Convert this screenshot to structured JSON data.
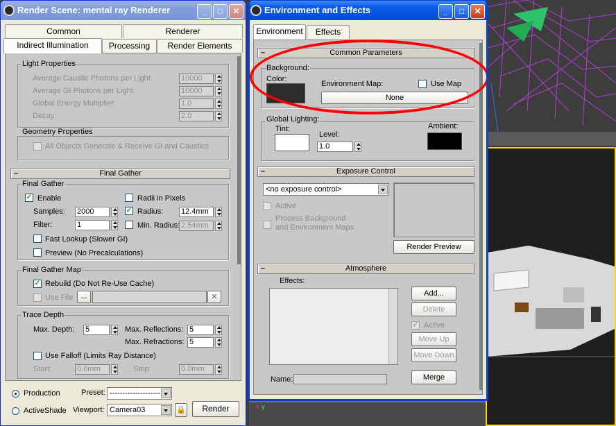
{
  "render_scene": {
    "title": "Render Scene: mental ray Renderer",
    "tabs_top": [
      "Common",
      "Renderer"
    ],
    "tabs_bottom": [
      "Indirect Illumination",
      "Processing",
      "Render Elements"
    ],
    "light_properties": {
      "title": "Light Properties",
      "caustic_label": "Average Caustic Photons per Light:",
      "caustic_value": "10000",
      "gi_label": "Average GI Photons per Light:",
      "gi_value": "10000",
      "energy_label": "Global Energy Multiplier:",
      "energy_value": "1.0",
      "decay_label": "Decay:",
      "decay_value": "2.0"
    },
    "geometry_properties": {
      "title": "Geometry Properties",
      "all_objects_label": "All Objects Generate & Receive GI and Caustics"
    },
    "final_gather_rollout": "Final Gather",
    "final_gather": {
      "title": "Final Gather",
      "enable_label": "Enable",
      "radii_label": "Radii in Pixels",
      "samples_label": "Samples:",
      "samples_value": "2000",
      "radius_label": "Radius:",
      "radius_value": "12.4mm",
      "filter_label": "Filter:",
      "filter_value": "1",
      "min_radius_label": "Min. Radius:",
      "min_radius_value": "2.54mm",
      "fast_lookup_label": "Fast Lookup (Slower GI)",
      "preview_label": "Preview (No Precalculations)"
    },
    "final_gather_map": {
      "title": "Final Gather Map",
      "rebuild_label": "Rebuild (Do Not Re-Use Cache)",
      "use_file_label": "Use File",
      "browse_label": "..."
    },
    "trace_depth": {
      "title": "Trace Depth",
      "max_depth_label": "Max. Depth:",
      "max_depth_value": "5",
      "max_reflections_label": "Max. Reflections:",
      "max_reflections_value": "5",
      "max_refractions_label": "Max. Refractions:",
      "max_refractions_value": "5",
      "use_falloff_label": "Use Falloff (Limits Ray Distance)",
      "start_label": "Start:",
      "start_value": "0.0mm",
      "stop_label": "Stop:",
      "stop_value": "0.0mm"
    },
    "footer": {
      "production_label": "Production",
      "activeshade_label": "ActiveShade",
      "preset_label": "Preset:",
      "preset_value": "--------------------",
      "viewport_label": "Viewport:",
      "viewport_value": "Camera03",
      "render_label": "Render"
    }
  },
  "env_effects": {
    "title": "Environment and Effects",
    "tabs": [
      "Environment",
      "Effects"
    ],
    "common_parameters_rollout": "Common Parameters",
    "background": {
      "title": "Background:",
      "color_label": "Color:",
      "env_map_label": "Environment Map:",
      "use_map_label": "Use Map",
      "map_button": "None",
      "color": "#2c2c2c"
    },
    "global_lighting": {
      "title": "Global Lighting:",
      "tint_label": "Tint:",
      "level_label": "Level:",
      "level_value": "1.0",
      "ambient_label": "Ambient:",
      "tint_color": "#ffffff",
      "ambient_color": "#000000"
    },
    "exposure_rollout": "Exposure Control",
    "exposure": {
      "dropdown_value": "<no exposure control>",
      "active_label": "Active",
      "process_bg_label_1": "Process Background",
      "process_bg_label_2": "and Environment Maps",
      "render_preview_label": "Render Preview"
    },
    "atmosphere_rollout": "Atmosphere",
    "atmosphere": {
      "effects_label": "Effects:",
      "add_label": "Add...",
      "delete_label": "Delete",
      "active_label": "Active",
      "move_up_label": "Move Up",
      "move_down_label": "Move Down",
      "name_label": "Name:",
      "merge_label": "Merge"
    }
  },
  "viewport": {
    "axis_x": "x",
    "axis_y": "y"
  },
  "colors": {
    "highlight": "#ff0000",
    "viewport_border": "#ffd700"
  }
}
